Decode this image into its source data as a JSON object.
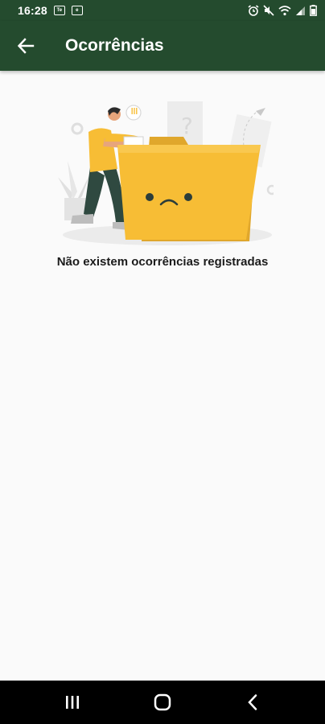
{
  "status_bar": {
    "time": "16:28",
    "notification_icons": [
      "Te",
      "e"
    ]
  },
  "app_bar": {
    "title": "Ocorrências",
    "color": "#244b2e"
  },
  "empty_state": {
    "message": "Não existem ocorrências registradas",
    "illustration": "sad-folder-illustration",
    "accent_color": "#f7bd35"
  },
  "nav_bar": {
    "buttons": [
      "recents-icon",
      "home-icon",
      "back-icon"
    ]
  }
}
